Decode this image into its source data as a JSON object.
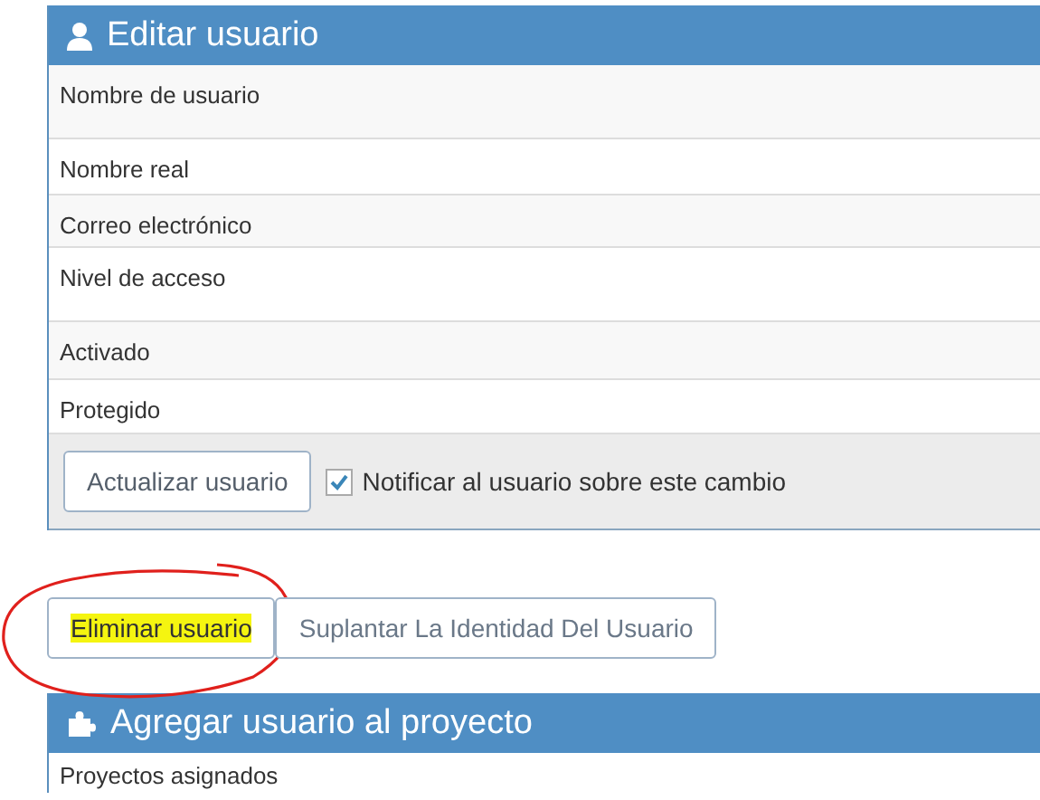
{
  "edit_panel": {
    "title": "Editar usuario",
    "rows": [
      {
        "label": "Nombre de usuario"
      },
      {
        "label": "Nombre real"
      },
      {
        "label": "Correo electrónico"
      },
      {
        "label": "Nivel de acceso"
      },
      {
        "label": "Activado"
      },
      {
        "label": "Protegido"
      }
    ],
    "update_button": "Actualizar usuario",
    "notify": {
      "label": "Notificar al usuario sobre este cambio",
      "checked": true
    }
  },
  "actions": [
    {
      "label": "Eliminar usuario",
      "highlighted": true,
      "circled": true
    },
    {
      "label": "Suplantar La Identidad Del Usuario",
      "highlighted": false,
      "circled": false
    }
  ],
  "project_panel": {
    "title": "Agregar usuario al proyecto",
    "rows": [
      {
        "label": "Proyectos asignados"
      }
    ]
  }
}
